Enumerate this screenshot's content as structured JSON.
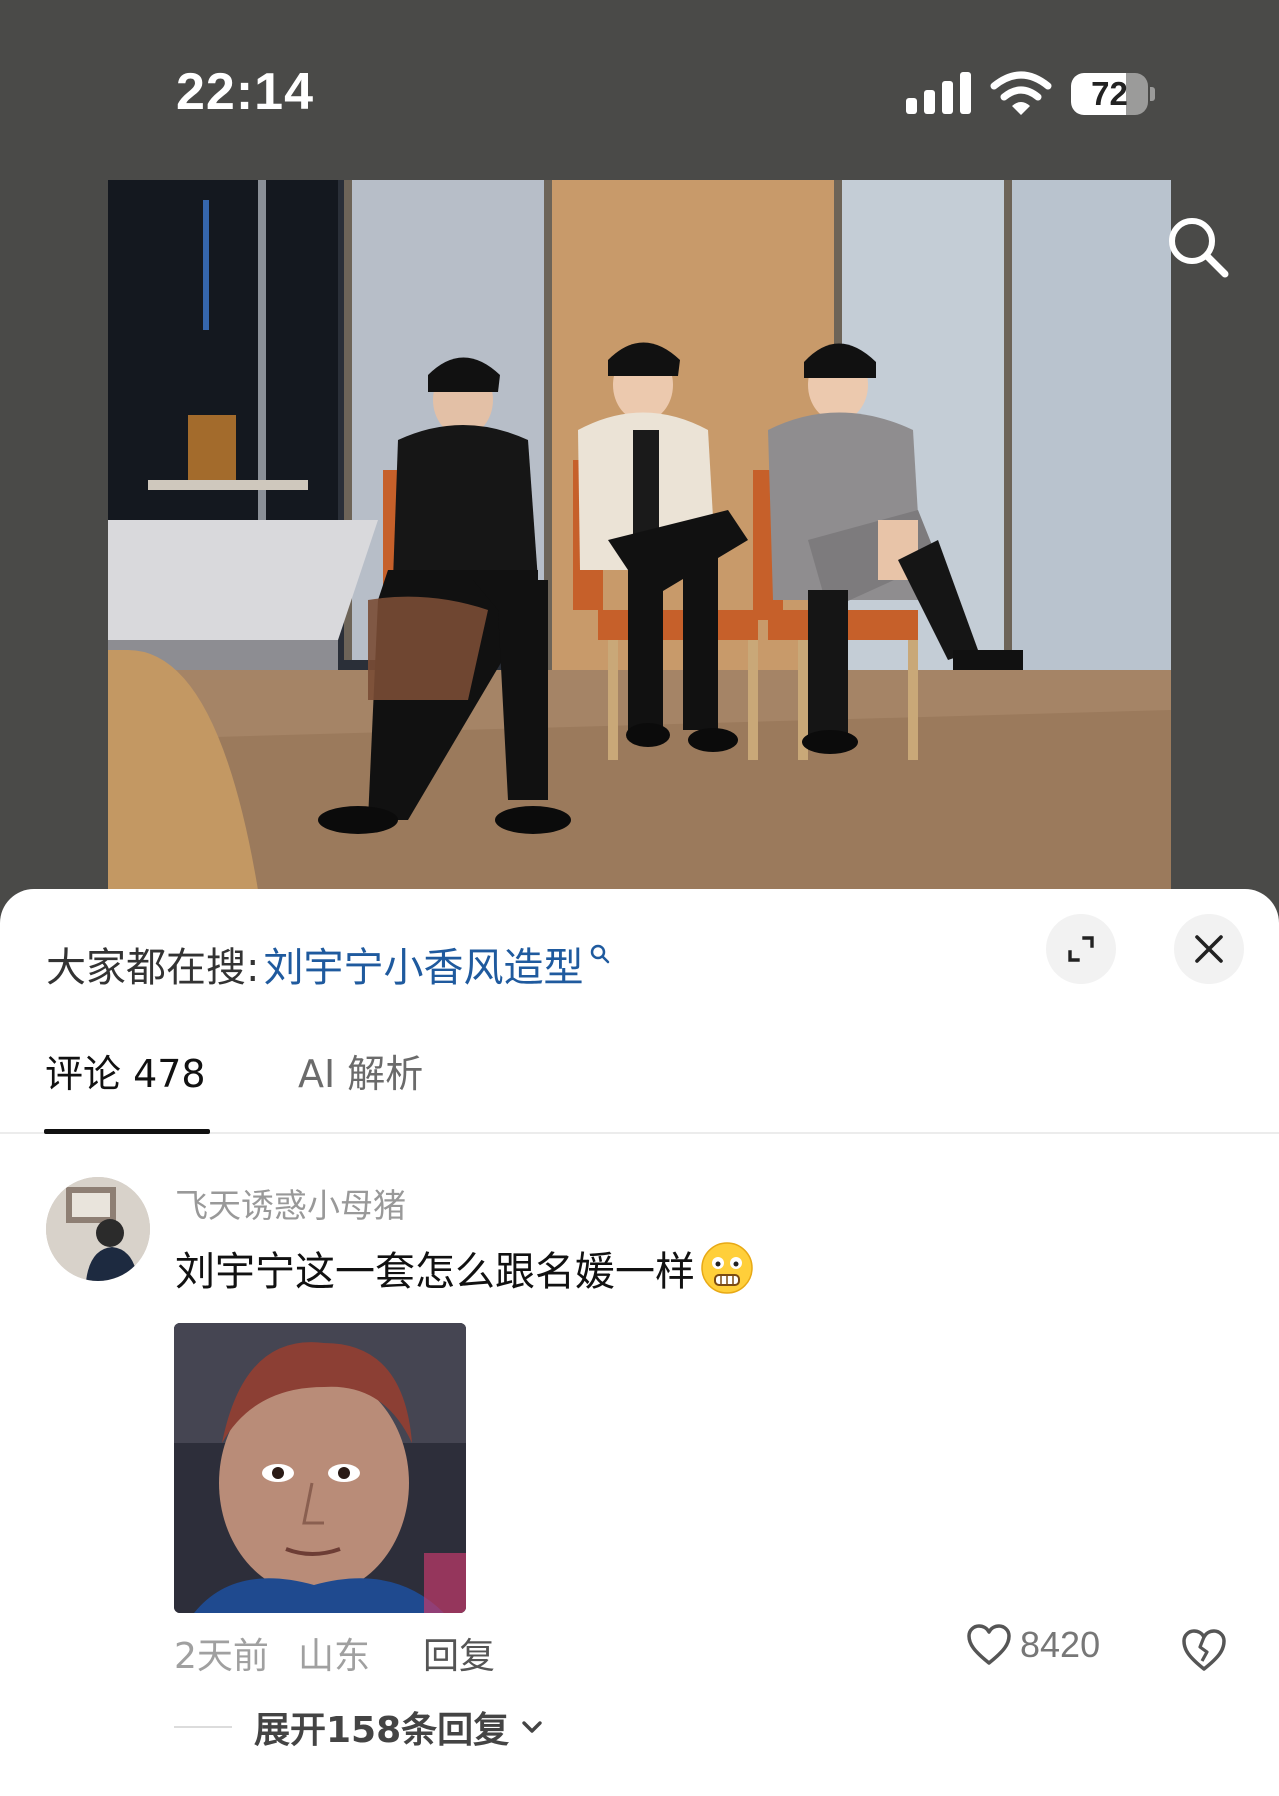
{
  "status_bar": {
    "time": "22:14",
    "battery_level": "72",
    "battery_fraction": 0.72,
    "signal_icon": "signal-icon",
    "wifi_icon": "wifi-icon"
  },
  "photo": {
    "search_icon": "search-icon"
  },
  "sheet": {
    "hot_search_prefix": "大家都在搜:",
    "hot_search_query": "刘宇宁小香风造型",
    "expand_icon": "expand-icon",
    "close_icon": "close-icon"
  },
  "tabs": [
    {
      "label": "评论 478",
      "active": true
    },
    {
      "label": "AI 解析",
      "active": false
    }
  ],
  "comment": {
    "username": "飞天诱惑小母猪",
    "text": "刘宇宁这一套怎么跟名媛一样",
    "emoji": "scared-face-emoji",
    "time": "2天前",
    "location": "山东",
    "reply_label": "回复",
    "like_count": "8420",
    "like_icon": "heart-icon",
    "dislike_icon": "broken-heart-icon",
    "expand_replies_label": "展开158条回复"
  },
  "colors": {
    "accent_link": "#1f5a9e",
    "background_dark": "#4a4a48"
  }
}
